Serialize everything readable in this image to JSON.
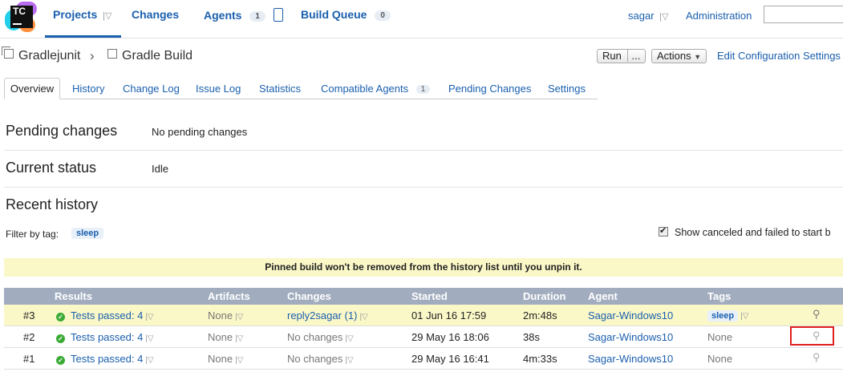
{
  "logo": {
    "text": "TC"
  },
  "nav": {
    "projects": "Projects",
    "changes": "Changes",
    "agents": "Agents",
    "agents_count": "1",
    "build_queue": "Build Queue",
    "build_queue_count": "0",
    "user": "sagar",
    "administration": "Administration"
  },
  "breadcrumb": {
    "project": "Gradlejunit",
    "build": "Gradle Build"
  },
  "actions": {
    "run": "Run",
    "run_more": "...",
    "actions": "Actions",
    "edit": "Edit Configuration Settings"
  },
  "tabs": {
    "overview": "Overview",
    "history": "History",
    "change_log": "Change Log",
    "issue_log": "Issue Log",
    "statistics": "Statistics",
    "compatible_agents": "Compatible Agents",
    "compatible_agents_count": "1",
    "pending_changes": "Pending Changes",
    "settings": "Settings"
  },
  "sections": {
    "pending_title": "Pending changes",
    "pending_value": "No pending changes",
    "status_title": "Current status",
    "status_value": "Idle",
    "history_title": "Recent history"
  },
  "filter": {
    "label": "Filter by tag:",
    "tag": "sleep",
    "show_canceled": "Show canceled and failed to start b"
  },
  "pinned_note": "Pinned build won't be removed from the history list until you unpin it.",
  "table": {
    "headers": {
      "results": "Results",
      "artifacts": "Artifacts",
      "changes": "Changes",
      "started": "Started",
      "duration": "Duration",
      "agent": "Agent",
      "tags": "Tags"
    },
    "rows": [
      {
        "num": "#3",
        "result": "Tests passed: 4",
        "artifacts": "None",
        "changes": "reply2sagar (1)",
        "started": "01 Jun 16 17:59",
        "duration": "2m:48s",
        "agent": "Sagar-Windows10",
        "tags": "sleep",
        "pinned": true
      },
      {
        "num": "#2",
        "result": "Tests passed: 4",
        "artifacts": "None",
        "changes": "No changes",
        "started": "29 May 16 18:06",
        "duration": "38s",
        "agent": "Sagar-Windows10",
        "tags": "None",
        "pinned": false
      },
      {
        "num": "#1",
        "result": "Tests passed: 4",
        "artifacts": "None",
        "changes": "No changes",
        "started": "29 May 16 16:41",
        "duration": "4m:33s",
        "agent": "Sagar-Windows10",
        "tags": "None",
        "pinned": false
      }
    ]
  },
  "colors": {
    "link": "#1a5fae",
    "header_bg": "#a1adbf",
    "pinned_bg": "#fbf8c8",
    "success": "#3bab36",
    "highlight": "#e02020"
  }
}
